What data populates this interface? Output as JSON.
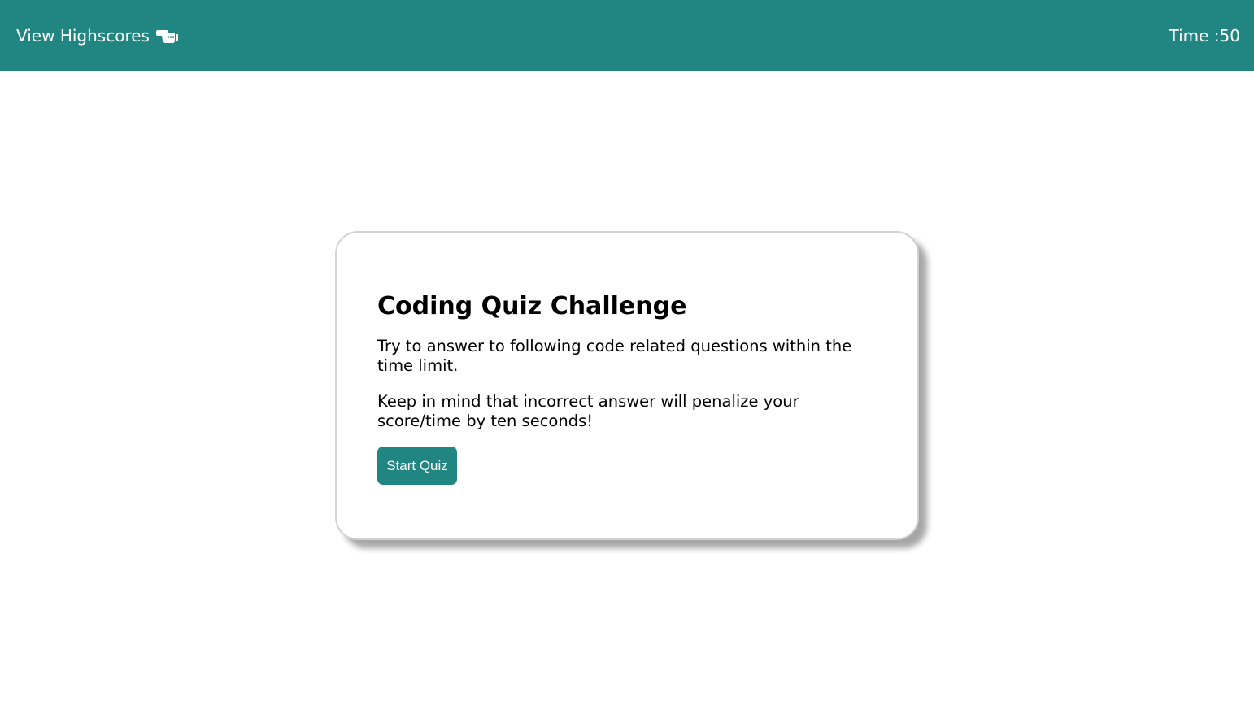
{
  "header": {
    "highscores_label": "View Highscores",
    "highscores_icon": "pointing-hand-icon",
    "timer_label": "Time :",
    "timer_value": "50",
    "background_color": "#218582"
  },
  "intro_card": {
    "title": "Coding Quiz Challenge",
    "paragraph_1": "Try to answer to following code related questions within the time limit.",
    "paragraph_2": "Keep in mind that incorrect answer will penalize your score/time by ten seconds!",
    "start_button_label": "Start Quiz",
    "button_color": "#218582"
  }
}
